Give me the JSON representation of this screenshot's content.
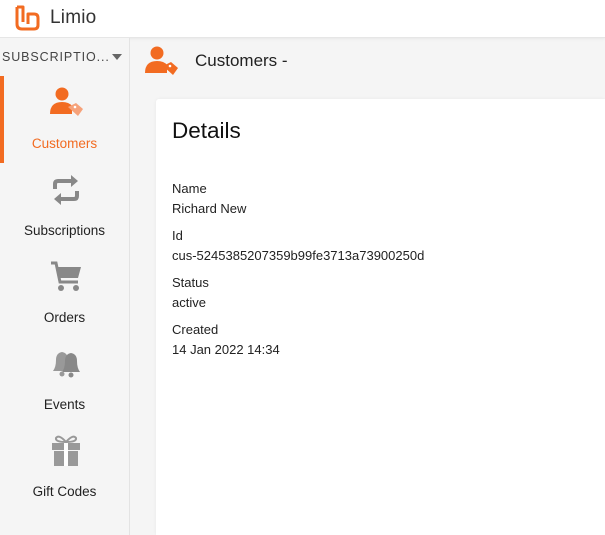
{
  "app": {
    "name": "Limio",
    "brand_color": "#f26b21"
  },
  "sidebar": {
    "selector_label": "SUBSCRIPTIO...",
    "items": [
      {
        "label": "Customers",
        "icon": "customer-tag-icon",
        "active": true
      },
      {
        "label": "Subscriptions",
        "icon": "repeat-icon",
        "active": false
      },
      {
        "label": "Orders",
        "icon": "cart-icon",
        "active": false
      },
      {
        "label": "Events",
        "icon": "bells-icon",
        "active": false
      },
      {
        "label": "Gift Codes",
        "icon": "gift-icon",
        "active": false
      }
    ]
  },
  "header": {
    "title": "Customers -",
    "icon": "customer-tag-icon"
  },
  "details": {
    "title": "Details",
    "fields": [
      {
        "label": "Name",
        "value": "Richard New"
      },
      {
        "label": "Id",
        "value": "cus-5245385207359b99fe3713a73900250d"
      },
      {
        "label": "Status",
        "value": "active"
      },
      {
        "label": "Created",
        "value": "14 Jan 2022 14:34"
      }
    ]
  }
}
